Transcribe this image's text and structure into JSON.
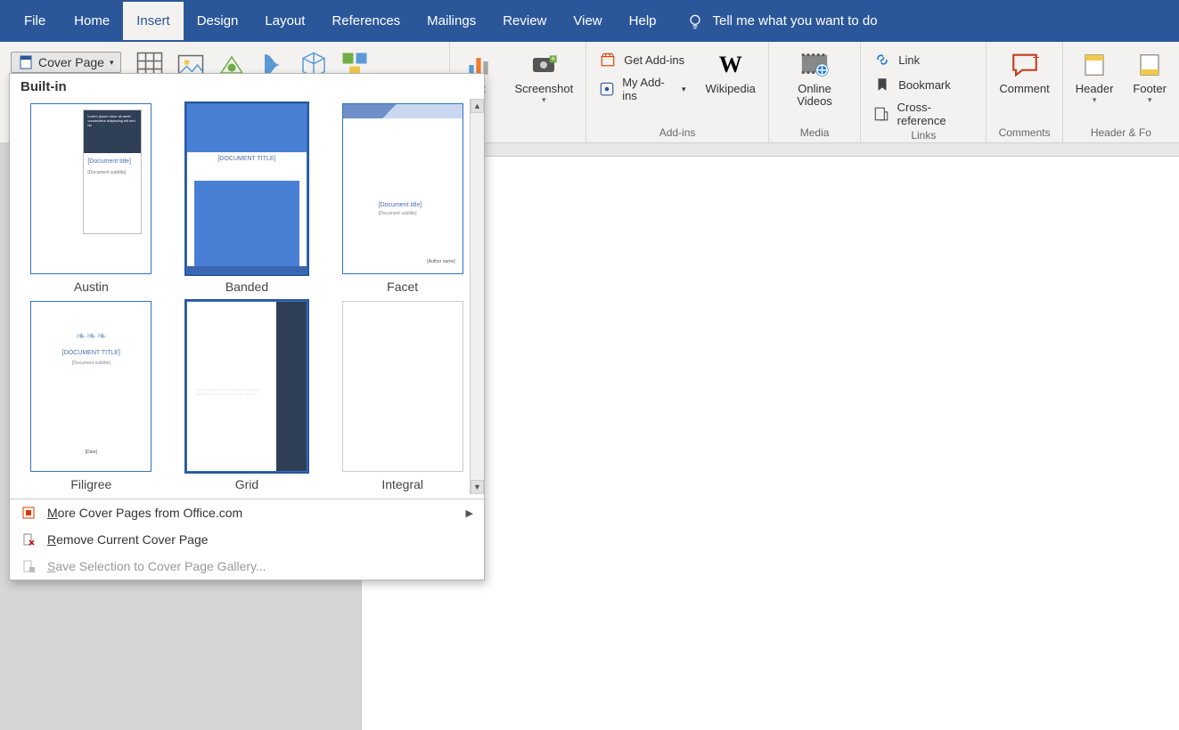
{
  "tabs": {
    "file": "File",
    "home": "Home",
    "insert": "Insert",
    "design": "Design",
    "layout": "Layout",
    "references": "References",
    "mailings": "Mailings",
    "review": "Review",
    "view": "View",
    "help": "Help",
    "tell": "Tell me what you want to do"
  },
  "coverBtn": "Cover Page",
  "ribbon": {
    "chart_partial": "art",
    "screenshot": "Screenshot",
    "getaddins": "Get Add-ins",
    "myaddins": "My Add-ins",
    "wikipedia": "Wikipedia",
    "addins_group": "Add-ins",
    "onlinevideos": "Online Videos",
    "media_group": "Media",
    "link": "Link",
    "bookmark": "Bookmark",
    "crossref": "Cross-reference",
    "links_group": "Links",
    "comment": "Comment",
    "comments_group": "Comments",
    "header": "Header",
    "footer": "Footer",
    "hf_group": "Header & Fo"
  },
  "dropdown": {
    "header": "Built-in",
    "items": [
      {
        "name": "Austin",
        "title": "[Document title]",
        "sub": "[Document subtitle]"
      },
      {
        "name": "Banded",
        "title": "[DOCUMENT TITLE]"
      },
      {
        "name": "Facet",
        "title": "[Document title]",
        "sub": "[Document subtitle]",
        "author": "[Author name]"
      },
      {
        "name": "Filigree",
        "title": "[DOCUMENT TITLE]",
        "sub": "[Document subtitle]",
        "date": "[Date]"
      },
      {
        "name": "Grid",
        "title": "[DOCUMENT TITLE]"
      },
      {
        "name": "Integral"
      }
    ],
    "more": "More Cover Pages from Office.com",
    "remove": "Remove Current Cover Page",
    "save": "Save Selection to Cover Page Gallery..."
  }
}
